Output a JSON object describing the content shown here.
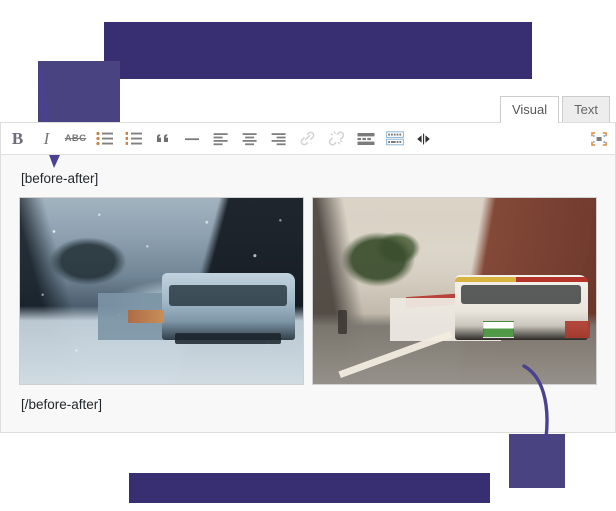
{
  "editor": {
    "tabs": [
      {
        "id": "visual",
        "label": "Visual",
        "active": true
      },
      {
        "id": "text",
        "label": "Text",
        "active": false
      }
    ],
    "toolbar": {
      "buttons": [
        {
          "name": "bold",
          "glyph": "B",
          "title": "Bold",
          "disabled": false
        },
        {
          "name": "italic",
          "glyph": "I",
          "title": "Italic",
          "disabled": false
        },
        {
          "name": "strikethrough",
          "glyph": "ABC",
          "title": "Strikethrough",
          "disabled": false
        },
        {
          "name": "bullet-list",
          "glyph": "",
          "title": "Bulleted list",
          "disabled": false
        },
        {
          "name": "numbered-list",
          "glyph": "",
          "title": "Numbered list",
          "disabled": false
        },
        {
          "name": "blockquote",
          "glyph": "“",
          "title": "Blockquote",
          "disabled": false
        },
        {
          "name": "horizontal-rule",
          "glyph": "",
          "title": "Horizontal line",
          "disabled": false
        },
        {
          "name": "align-left",
          "glyph": "",
          "title": "Align left",
          "disabled": false
        },
        {
          "name": "align-center",
          "glyph": "",
          "title": "Align center",
          "disabled": false
        },
        {
          "name": "align-right",
          "glyph": "",
          "title": "Align right",
          "disabled": false
        },
        {
          "name": "insert-link",
          "glyph": "",
          "title": "Insert/edit link",
          "disabled": true
        },
        {
          "name": "remove-link",
          "glyph": "",
          "title": "Remove link",
          "disabled": true
        },
        {
          "name": "read-more",
          "glyph": "",
          "title": "Insert Read More tag",
          "disabled": false
        },
        {
          "name": "toolbar-toggle",
          "glyph": "",
          "title": "Toolbar Toggle",
          "disabled": false
        },
        {
          "name": "before-after",
          "glyph": "",
          "title": "Before / After",
          "disabled": false
        },
        {
          "name": "fullscreen",
          "glyph": "",
          "title": "Distraction-free writing mode",
          "disabled": false
        }
      ]
    },
    "content": {
      "shortcode_open": "[before-after]",
      "shortcode_close": "[/before-after]",
      "images": [
        {
          "name": "before-image",
          "alt": "Snowy winter city street with articulated bus, cold blue color grade"
        },
        {
          "name": "after-image",
          "alt": "Sunny San Francisco street with white and red articulated bus, warm natural colors"
        }
      ]
    }
  },
  "annotations": {
    "color_dark": "#372f72",
    "color_light": "#4a4382",
    "blocks": [
      {
        "name": "redaction-top-wide"
      },
      {
        "name": "redaction-top-left"
      },
      {
        "name": "redaction-bottom-bar"
      },
      {
        "name": "redaction-bottom-right"
      }
    ],
    "arrows": [
      {
        "name": "arrow-pointing-to-editor-toolbar"
      },
      {
        "name": "arrow-curve-to-bottom-block"
      }
    ]
  }
}
